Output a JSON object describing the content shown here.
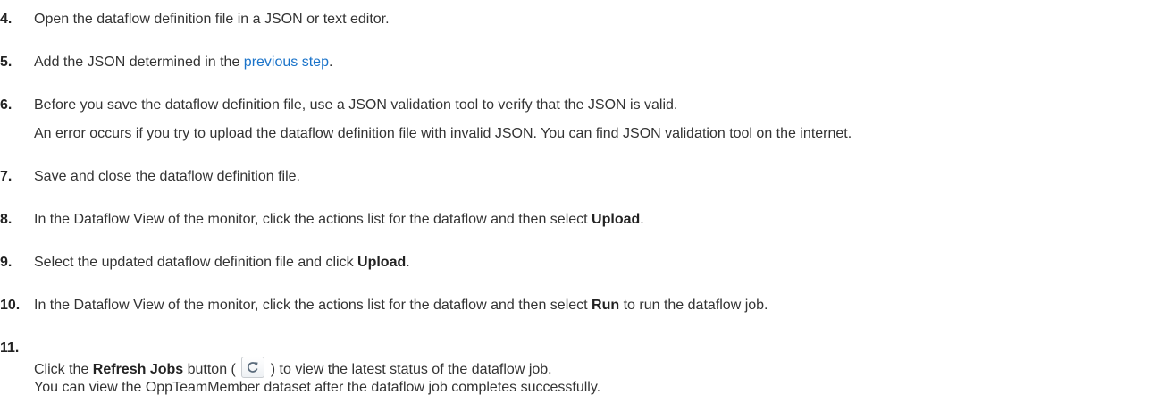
{
  "steps": [
    {
      "num": "4.",
      "text": "Open the dataflow definition file in a JSON or text editor."
    },
    {
      "num": "5.",
      "pre": "Add the JSON determined in the ",
      "link": "previous step",
      "post": "."
    },
    {
      "num": "6.",
      "text": "Before you save the dataflow definition file, use a JSON validation tool to verify that the JSON is valid.",
      "note": "An error occurs if you try to upload the dataflow definition file with invalid JSON. You can find JSON validation tool on the internet."
    },
    {
      "num": "7.",
      "text": "Save and close the dataflow definition file."
    },
    {
      "num": "8.",
      "pre": "In the Dataflow View of the monitor, click the actions list for the dataflow and then select ",
      "bold": "Upload",
      "post": "."
    },
    {
      "num": "9.",
      "pre": "Select the updated dataflow definition file and click ",
      "bold": "Upload",
      "post": "."
    },
    {
      "num": "10.",
      "pre": "In the Dataflow View of the monitor, click the actions list for the dataflow and then select ",
      "bold": "Run",
      "post": " to run the dataflow job."
    },
    {
      "num": "11.",
      "pre": "Click the ",
      "bold": "Refresh Jobs",
      "mid": " button ( ",
      "post": " ) to view the latest status of the dataflow job.",
      "note": "You can view the OppTeamMember dataset after the dataflow job completes successfully.",
      "icon": "refresh-icon"
    }
  ],
  "colors": {
    "link": "#1a73c9",
    "text": "#333333"
  }
}
